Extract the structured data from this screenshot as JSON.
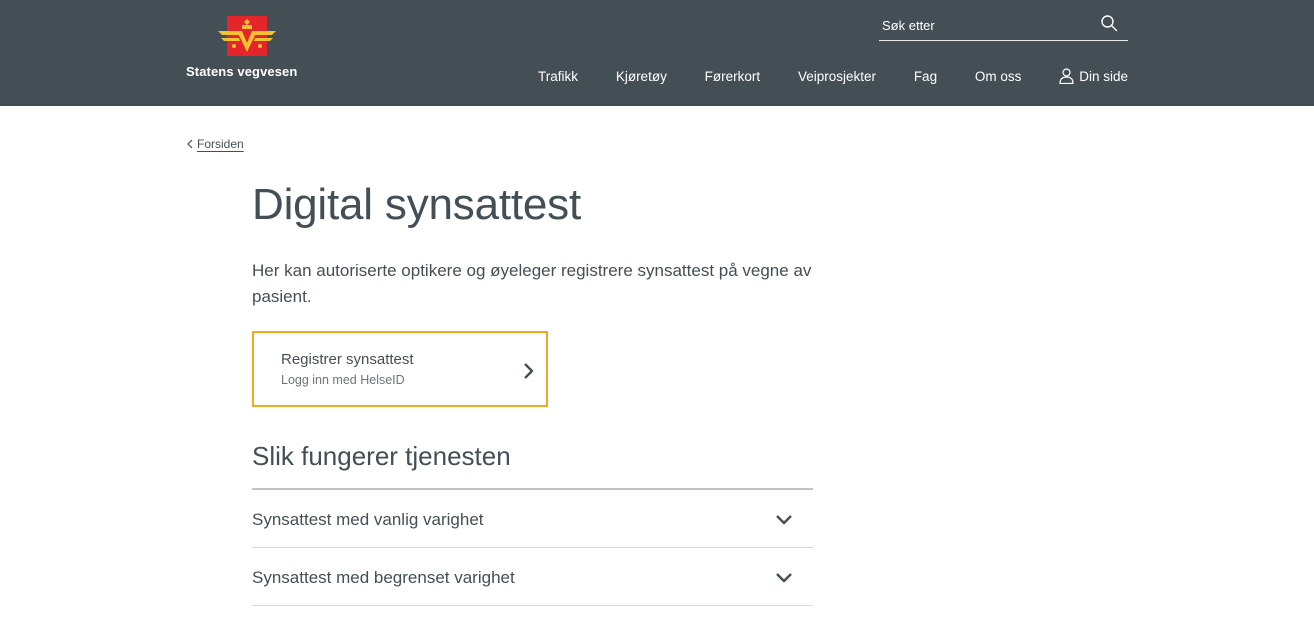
{
  "header": {
    "brand_name": "Statens vegvesen",
    "logo_icon": "statens-vegvesen-crest-icon",
    "search": {
      "placeholder": "Søk etter",
      "value": "",
      "icon": "search-icon"
    },
    "nav": [
      {
        "label": "Trafikk"
      },
      {
        "label": "Kjøretøy"
      },
      {
        "label": "Førerkort"
      },
      {
        "label": "Veiprosjekter"
      },
      {
        "label": "Fag"
      },
      {
        "label": "Om oss"
      },
      {
        "label": "Din side",
        "icon": "user-icon"
      }
    ]
  },
  "breadcrumb": {
    "label": "Forsiden",
    "icon": "chevron-left-icon"
  },
  "page": {
    "title": "Digital synsattest",
    "intro": "Her kan autoriserte optikere og øyeleger registrere synsattest på vegne av pasient."
  },
  "action_card": {
    "title": "Registrer synsattest",
    "subtitle": "Logg inn med HelseID",
    "icon": "chevron-right-icon"
  },
  "section": {
    "title": "Slik fungerer tjenesten",
    "accordion": [
      {
        "label": "Synsattest med vanlig varighet",
        "icon": "chevron-down-icon"
      },
      {
        "label": "Synsattest med begrenset varighet",
        "icon": "chevron-down-icon"
      }
    ]
  },
  "colors": {
    "header_bg": "#444f55",
    "text": "#444f55",
    "card_border": "#f2a91e",
    "logo_red": "#e4252c",
    "logo_gold": "#f2c230"
  }
}
